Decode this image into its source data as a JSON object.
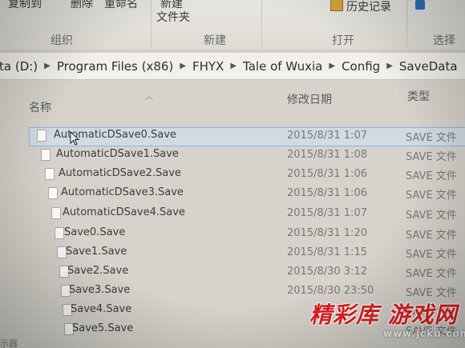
{
  "ribbon": {
    "copy_to": "复制到",
    "delete": "删除",
    "rename": "重命名",
    "new_item": "新建",
    "new_folder": "文件夹",
    "history": "历史记录",
    "groups": {
      "organize": "组织",
      "new": "新建",
      "open": "打开",
      "select": "选择"
    }
  },
  "address": {
    "crumbs": [
      "ta (D:)",
      "Program Files (x86)",
      "FHYX",
      "Tale of Wuxia",
      "Config",
      "SaveData"
    ]
  },
  "columns": {
    "name": "名称",
    "date": "修改日期",
    "type": "类型"
  },
  "files": [
    {
      "name": "AutomaticDSave0.Save",
      "date": "2015/8/31 1:07",
      "type": "SAVE 文件"
    },
    {
      "name": "AutomaticDSave1.Save",
      "date": "2015/8/31 1:08",
      "type": "SAVE 文件"
    },
    {
      "name": "AutomaticDSave2.Save",
      "date": "2015/8/31 1:06",
      "type": "SAVE 文件"
    },
    {
      "name": "AutomaticDSave3.Save",
      "date": "2015/8/31 1:06",
      "type": "SAVE 文件"
    },
    {
      "name": "AutomaticDSave4.Save",
      "date": "2015/8/31 1:07",
      "type": "SAVE 文件"
    },
    {
      "name": "Save0.Save",
      "date": "2015/8/31 1:20",
      "type": "SAVE 文件"
    },
    {
      "name": "Save1.Save",
      "date": "2015/8/31 1:15",
      "type": "SAVE 文件"
    },
    {
      "name": "Save2.Save",
      "date": "2015/8/30 3:12",
      "type": "SAVE 文件"
    },
    {
      "name": "Save3.Save",
      "date": "2015/8/30 23:50",
      "type": "SAVE 文件"
    },
    {
      "name": "Save4.Save",
      "date": "",
      "type": "SAVE 文件"
    },
    {
      "name": "Save5.Save",
      "date": "",
      "type": "SAVE 文件"
    }
  ],
  "status": "示器",
  "watermark": {
    "text": "精彩库 游戏网",
    "url": "www.jcku.com"
  },
  "colors": {
    "selection": "#cde2f6",
    "watermark": "#e02020"
  },
  "icons": [
    "file-icon",
    "sort-up-icon",
    "history-icon",
    "mouse-pointer-icon",
    "chevron-right-icon"
  ]
}
